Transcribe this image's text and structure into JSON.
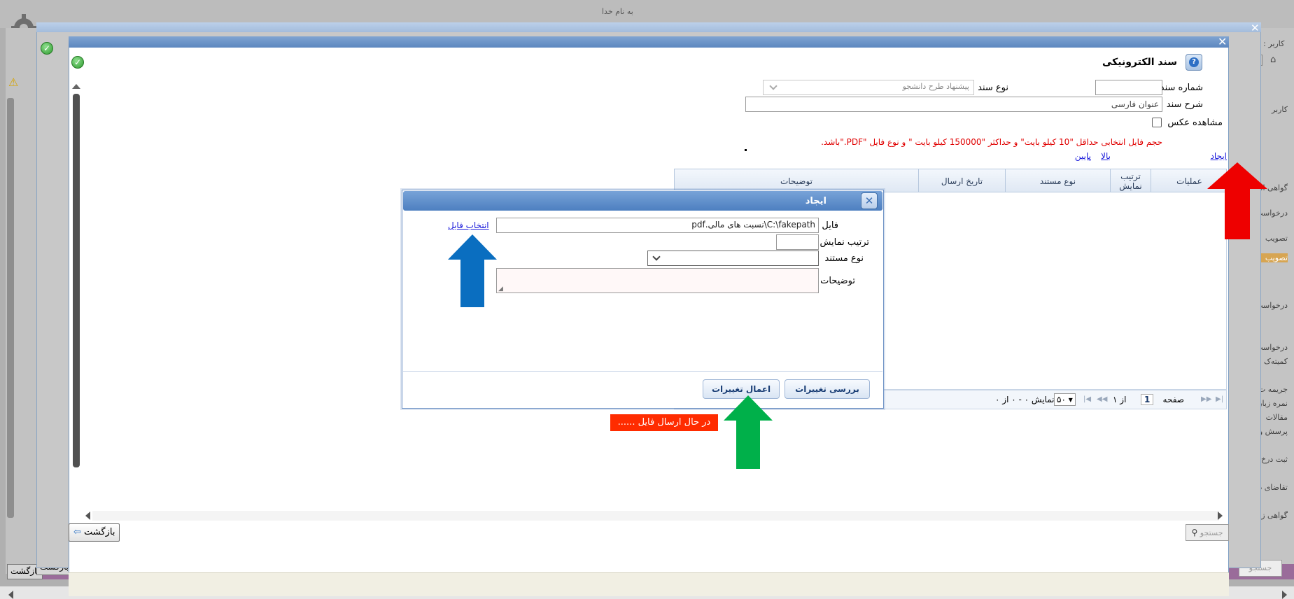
{
  "background": {
    "header_text": "به نام خدا",
    "user_label": "کاربر : مد",
    "sidebar_items": [
      "کاربر",
      "گواهی اشتغال",
      "درخواست",
      "تصویب",
      "تصویب",
      "درخواست ارشد/پیا",
      "درخواست حذف ام",
      "کمیته‌ک",
      "جریمه ت",
      "نمره زبان",
      "مقالات",
      "پرسش و",
      "ثبت درخ",
      "تقاضای دانشنامه",
      "گواهی ز"
    ],
    "back_label": "بازگشت",
    "search_label": "جستجو",
    "page_indicator": "1 ح"
  },
  "dialog": {
    "title": "سند الکترونیکی",
    "doc_number_label": "شماره سند",
    "doc_number_value": "",
    "doc_type_label": "نوع سند",
    "doc_type_value": "پیشنهاد طرح دانشجو",
    "doc_desc_label": "شرح سند",
    "doc_desc_value": "عنوان فارسی",
    "view_photo_label": "مشاهده عکس",
    "warning": "حجم فایل انتخابی حداقل \"10 کیلو بایت\" و حداکثر \"150000 کیلو بایت \" و نوع فایل \"PDF.\"باشد.",
    "create_link": "ایجاد",
    "up_link": "بالا",
    "down_link": "پایین",
    "back_label": "بازگشت",
    "search_label": "جستجو",
    "grid": {
      "columns": [
        "عملیات",
        "ترتیب نمایش",
        "نوع مستند",
        "تاریخ ارسال",
        "توضیحات"
      ]
    },
    "pager": {
      "page_label": "صفحه",
      "page_value": "1",
      "of_label": "از ۱",
      "page_size": "۵۰",
      "display_text": "نمایش ۰ - ۰ از ۰"
    }
  },
  "subdialog": {
    "title": "ایجاد",
    "file_label": "فایل",
    "file_value": "C:\\fakepath\\نسبت های مالی.pdf",
    "choose_file_link": "انتخاب فایل",
    "order_label": "ترتیب نمایش",
    "order_value": "",
    "doc_type_label": "نوع مستند",
    "doc_type_value": "",
    "desc_label": "توضیحات",
    "desc_value": "",
    "review_button": "بررسی تغییرات",
    "apply_button": "اعمال تغییرات"
  },
  "status": {
    "sending_text": "در حال ارسال فایل ......"
  },
  "colors": {
    "arrow_red": "#ee0000",
    "arrow_blue": "#0a6ec0",
    "arrow_green": "#00b04a",
    "warning": "#e00000",
    "sending_bg": "#ff2c00"
  }
}
